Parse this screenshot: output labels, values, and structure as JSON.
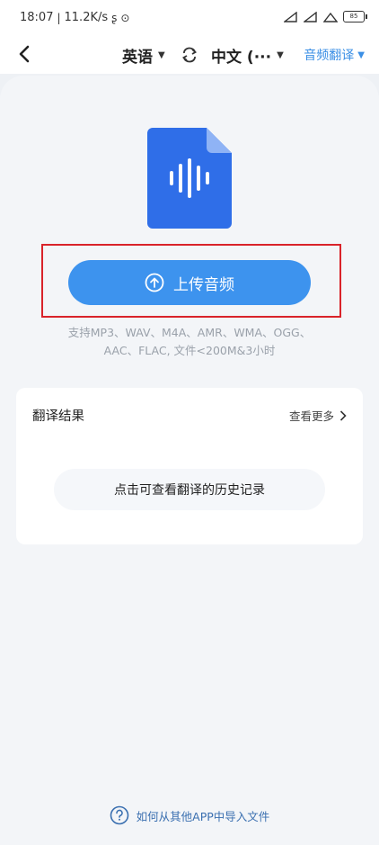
{
  "status_bar": {
    "time": "18:07",
    "speed": "11.2K/s",
    "battery": "85"
  },
  "nav": {
    "source_language": "英语",
    "target_language": "中文 (···",
    "mode": "音频翻译"
  },
  "upload": {
    "button_label": "上传音频",
    "formats_line1": "支持MP3、WAV、M4A、AMR、WMA、OGG、",
    "formats_line2": "AAC、FLAC, 文件<200M&3小时"
  },
  "results": {
    "title": "翻译结果",
    "more_label": "查看更多",
    "history_button": "点击可查看翻译的历史记录"
  },
  "help": {
    "label": "如何从其他APP中导入文件"
  },
  "colors": {
    "accent": "#3d93ee",
    "highlight_border": "#d9232a",
    "file_icon": "#2f6ee8"
  }
}
